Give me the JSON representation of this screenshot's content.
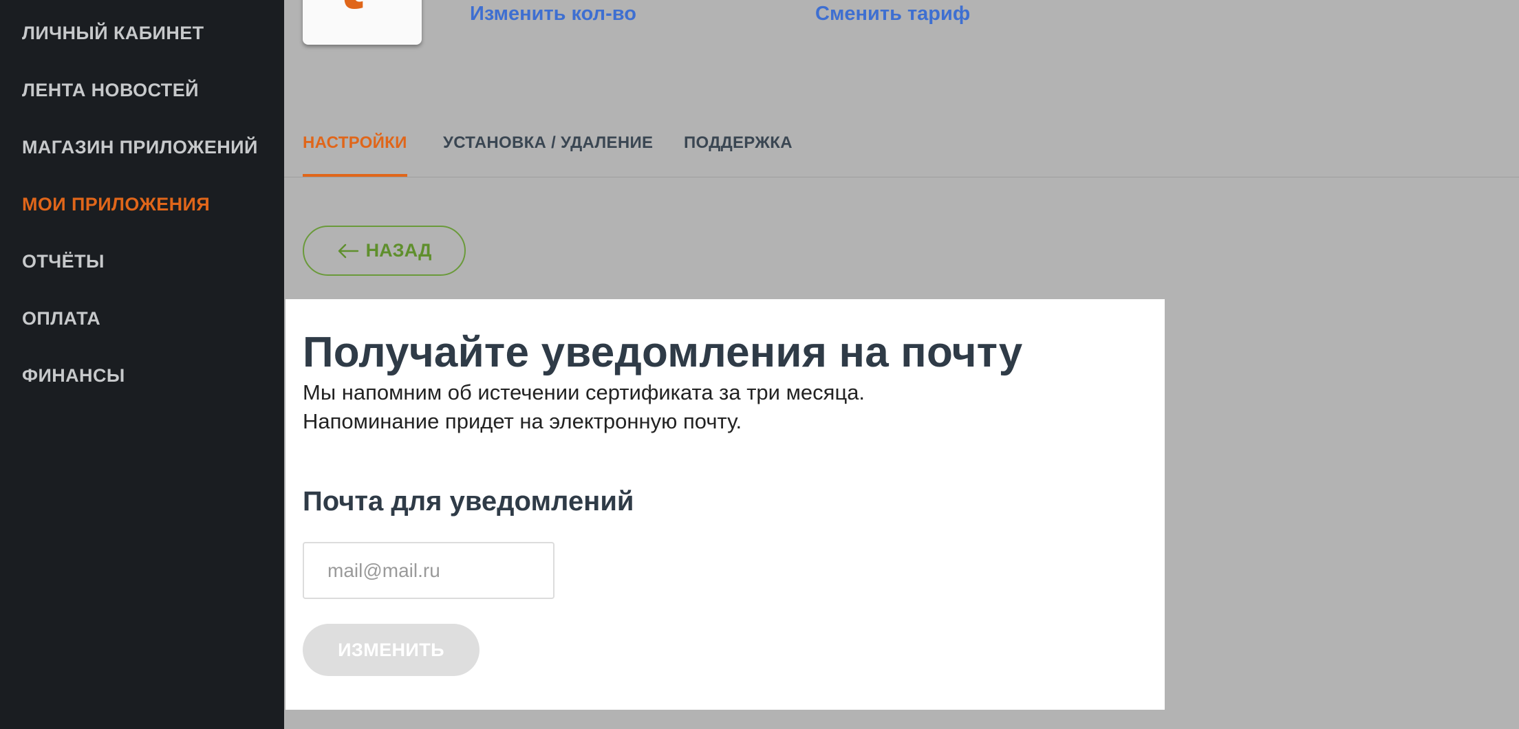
{
  "sidebar": {
    "items": [
      {
        "label": "ЛИЧНЫЙ КАБИНЕТ"
      },
      {
        "label": "ЛЕНТА НОВОСТЕЙ"
      },
      {
        "label": "МАГАЗИН ПРИЛОЖЕНИЙ"
      },
      {
        "label": "МОИ ПРИЛОЖЕНИЯ",
        "active": true
      },
      {
        "label": "ОТЧЁТЫ"
      },
      {
        "label": "ОПЛАТА"
      },
      {
        "label": "ФИНАНСЫ"
      }
    ]
  },
  "app_header": {
    "change_quantity_link": "Изменить кол-во",
    "change_tariff_link": "Сменить тариф"
  },
  "tabs": [
    {
      "label": "НАСТРОЙКИ",
      "active": true
    },
    {
      "label": "УСТАНОВКА / УДАЛЕНИЕ"
    },
    {
      "label": "ПОДДЕРЖКА"
    }
  ],
  "back_button": {
    "label": "НАЗАД"
  },
  "notification_card": {
    "title": "Получайте уведомления на почту",
    "description_line1": "Мы напомним об истечении сертификата за три месяца.",
    "description_line2": "Напоминание придет на электронную почту.",
    "email_label": "Почта для уведомлений",
    "email_placeholder": "mail@mail.ru",
    "email_value": "",
    "submit_label": "ИЗМЕНИТЬ"
  },
  "colors": {
    "accent": "#e0661a",
    "link": "#3e6fd1",
    "back_green": "#5f8f2d",
    "sidebar_bg": "#1a1d21",
    "overlay_bg": "#b3b3b3"
  }
}
